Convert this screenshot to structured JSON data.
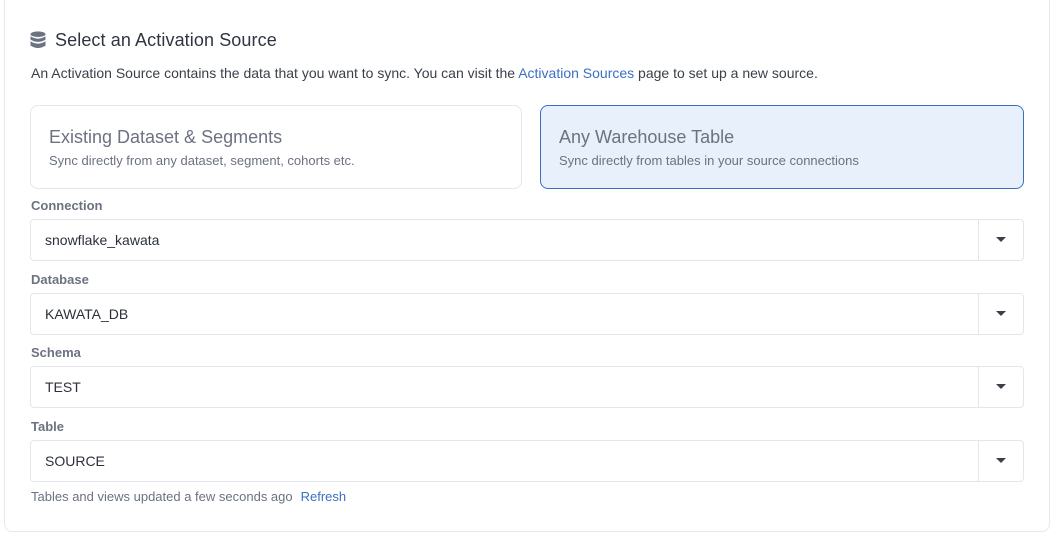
{
  "header": {
    "title": "Select an Activation Source",
    "icon": "database-icon"
  },
  "description": {
    "before_link": "An Activation Source contains the data that you want to sync. You can visit the ",
    "link": "Activation Sources",
    "after_link": " page to set up a new source."
  },
  "options": [
    {
      "title": "Existing Dataset & Segments",
      "subtitle": "Sync directly from any dataset, segment, cohorts etc.",
      "selected": false
    },
    {
      "title": "Any Warehouse Table",
      "subtitle": "Sync directly from tables in your source connections",
      "selected": true
    }
  ],
  "fields": {
    "connection": {
      "label": "Connection",
      "value": "snowflake_kawata"
    },
    "database": {
      "label": "Database",
      "value": "KAWATA_DB"
    },
    "schema": {
      "label": "Schema",
      "value": "TEST"
    },
    "table": {
      "label": "Table",
      "value": "SOURCE"
    }
  },
  "footer": {
    "status": "Tables and views updated a few seconds ago",
    "refresh": "Refresh"
  },
  "colors": {
    "accent": "#3b6fc2",
    "selected_bg": "#e8f0fc"
  }
}
